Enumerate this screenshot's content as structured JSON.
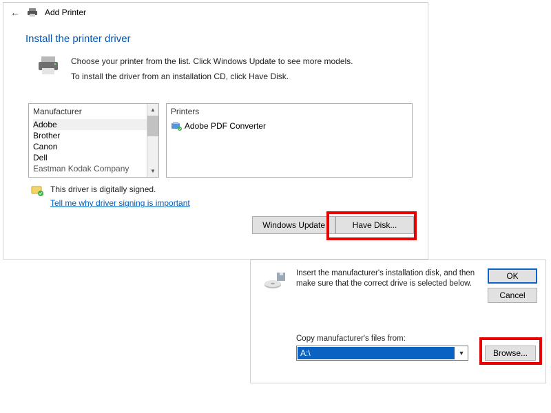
{
  "window": {
    "title": "Add Printer",
    "heading": "Install the printer driver",
    "desc1": "Choose your printer from the list. Click Windows Update to see more models.",
    "desc2": "To install the driver from an installation CD, click Have Disk."
  },
  "lists": {
    "manufacturer_header": "Manufacturer",
    "printers_header": "Printers",
    "manufacturers": [
      {
        "label": "Adobe",
        "selected": true
      },
      {
        "label": "Brother"
      },
      {
        "label": "Canon"
      },
      {
        "label": "Dell"
      },
      {
        "label": "Eastman Kodak Company",
        "cut": true
      }
    ],
    "printer_item": "Adobe PDF Converter"
  },
  "signed": {
    "text": "This driver is digitally signed.",
    "link": "Tell me why driver signing is important"
  },
  "buttons": {
    "windows_update": "Windows Update",
    "have_disk": "Have Disk..."
  },
  "subdialog": {
    "message": "Insert the manufacturer's installation disk, and then make sure that the correct drive is selected below.",
    "ok": "OK",
    "cancel": "Cancel",
    "copy_label": "Copy manufacturer's files from:",
    "drive_value": "A:\\",
    "browse": "Browse..."
  }
}
